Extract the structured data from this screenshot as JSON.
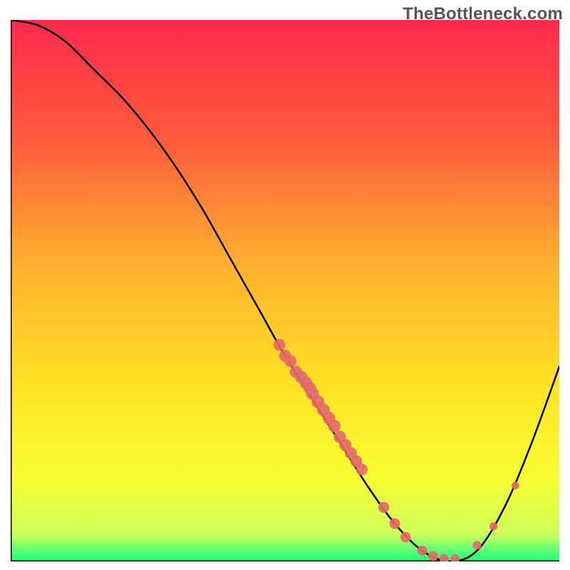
{
  "watermark": "TheBottleneck.com",
  "chart_data": {
    "type": "line",
    "title": "",
    "xlabel": "",
    "ylabel": "",
    "xlim": [
      0,
      100
    ],
    "ylim": [
      0,
      100
    ],
    "grid": false,
    "legend": false,
    "series": [
      {
        "name": "curve",
        "x": [
          0,
          5,
          10,
          15,
          20,
          25,
          30,
          35,
          40,
          45,
          50,
          55,
          60,
          65,
          70,
          75,
          80,
          85,
          90,
          95,
          100
        ],
        "y": [
          100,
          99,
          96,
          91,
          86,
          80,
          73,
          65,
          56,
          47,
          38,
          30,
          22,
          14,
          7,
          2,
          0,
          2,
          10,
          22,
          36
        ]
      }
    ],
    "highlight_points": {
      "name": "markers",
      "x": [
        49,
        50,
        51,
        52,
        53,
        53.8,
        54.5,
        55,
        56,
        57,
        58,
        59,
        60,
        61,
        62,
        63,
        64,
        68,
        70,
        72,
        75,
        77,
        79,
        81,
        85,
        88,
        92
      ],
      "y": [
        40,
        38,
        37,
        35,
        34,
        33,
        32,
        31,
        29.5,
        28,
        26.5,
        25,
        23,
        21.5,
        20,
        18.5,
        17,
        10,
        7,
        4.5,
        2,
        1,
        0.5,
        0.5,
        3,
        6.5,
        14
      ]
    },
    "gradient_stops": [
      {
        "offset": 0.0,
        "color": "#ff2a4d"
      },
      {
        "offset": 0.22,
        "color": "#ff5a3c"
      },
      {
        "offset": 0.45,
        "color": "#ffb02e"
      },
      {
        "offset": 0.68,
        "color": "#ffe324"
      },
      {
        "offset": 0.85,
        "color": "#f7ff33"
      },
      {
        "offset": 0.95,
        "color": "#cdff5a"
      },
      {
        "offset": 0.985,
        "color": "#4bff7a"
      },
      {
        "offset": 1.0,
        "color": "#18ff6b"
      }
    ],
    "marker_color": "#e46a6a",
    "marker_radius_min": 5,
    "marker_radius_max": 9,
    "curve_color": "#000000",
    "curve_width": 2.5,
    "axis_color": "#000000",
    "axis_width": 3
  }
}
